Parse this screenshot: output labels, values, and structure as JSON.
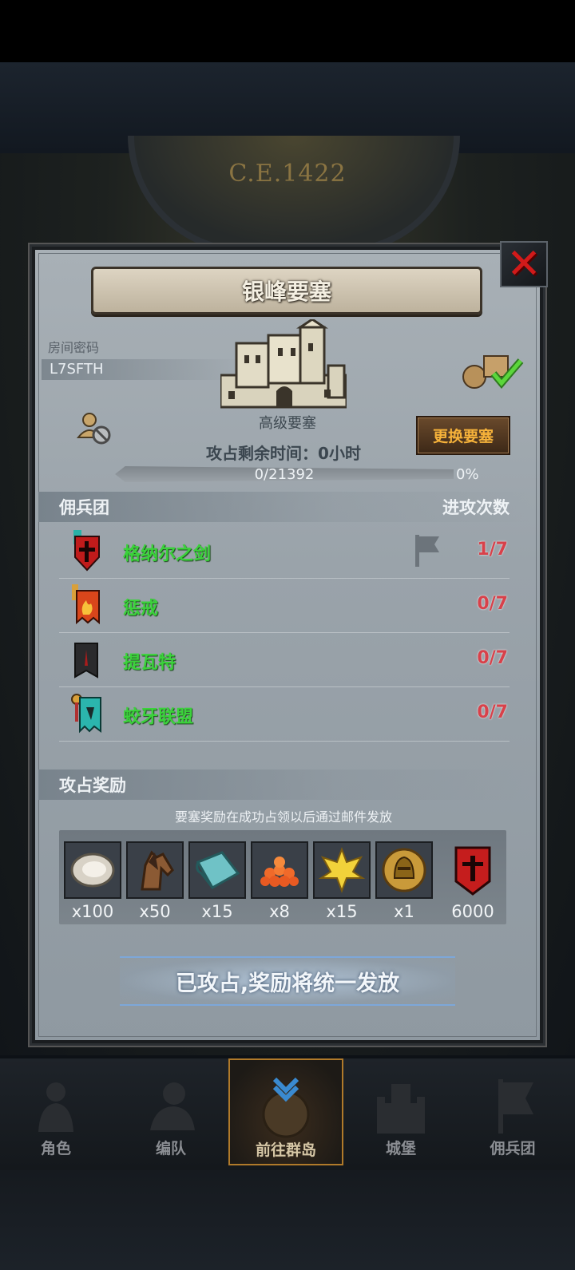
{
  "background": {
    "era_label": "C.E.1422"
  },
  "dialog": {
    "title": "银峰要塞",
    "close_label": "✕",
    "room_code_label": "房间密码",
    "room_code": "L7SFTH",
    "fortress_grade": "高级要塞",
    "time_left": "攻占剩余时间：0小时",
    "change_button": "更换要塞",
    "progress": {
      "text": "0/21392",
      "percent_label": "0%",
      "fraction": 0
    },
    "mercenary_section": {
      "left": "佣兵团",
      "right": "进攻次数"
    },
    "mercenaries": [
      {
        "name": "格纳尔之剑",
        "attacks": "1/7"
      },
      {
        "name": "惩戒",
        "attacks": "0/7"
      },
      {
        "name": "提瓦特",
        "attacks": "0/7"
      },
      {
        "name": "蛟牙联盟",
        "attacks": "0/7"
      }
    ],
    "rewards_section": {
      "left": "攻占奖励"
    },
    "rewards_note": "要塞奖励在成功占领以后通过邮件发放",
    "rewards": [
      {
        "icon": "oyster-icon",
        "qty": "x100"
      },
      {
        "icon": "horse-icon",
        "qty": "x50"
      },
      {
        "icon": "cloth-icon",
        "qty": "x15"
      },
      {
        "icon": "roe-icon",
        "qty": "x8"
      },
      {
        "icon": "golden-crest-icon",
        "qty": "x15"
      },
      {
        "icon": "helmet-coin-icon",
        "qty": "x1"
      },
      {
        "icon": "mercenary-banner-icon",
        "qty": "6000"
      }
    ],
    "status_text": "已攻占,奖励将统一发放"
  },
  "bottom_nav": [
    {
      "label": "角色",
      "icon": "knight-icon"
    },
    {
      "label": "编队",
      "icon": "team-icon"
    },
    {
      "label": "前往群岛",
      "icon": "island-icon",
      "active": true
    },
    {
      "label": "城堡",
      "icon": "castle-icon"
    },
    {
      "label": "佣兵团",
      "icon": "mercenary-icon"
    }
  ],
  "colors": {
    "accent_green": "#3bd23b",
    "attack_red": "#d8414a",
    "button_orange": "#f6b23a"
  }
}
